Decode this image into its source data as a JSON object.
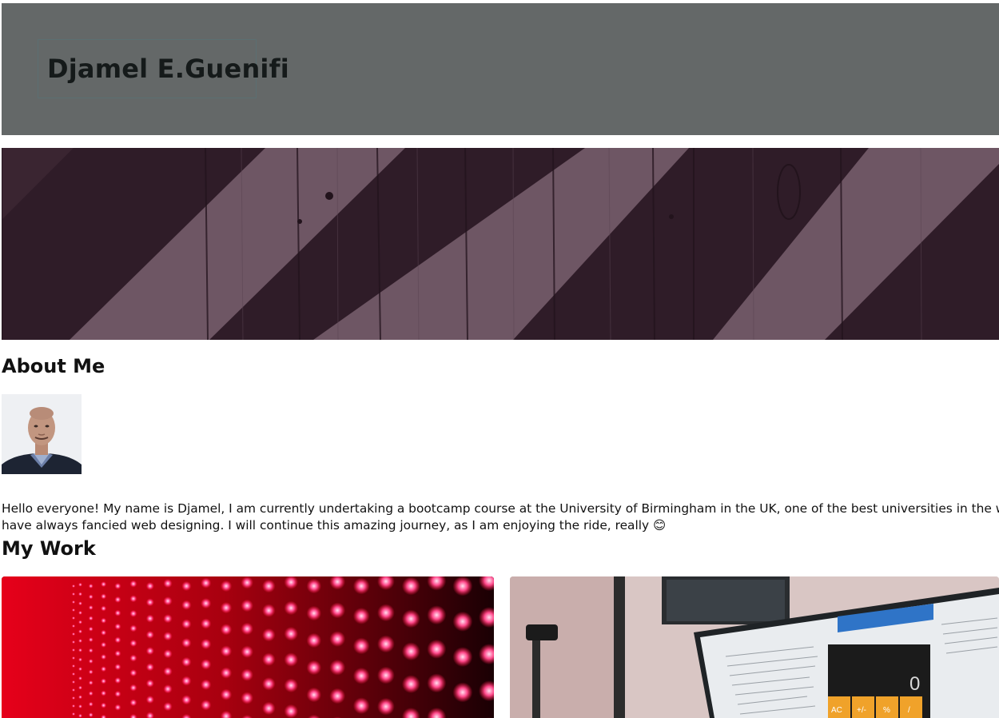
{
  "header": {
    "brand_name": "Djamel E.Guenifi"
  },
  "hero": {
    "image": "wood-plank-diagonal-stripes",
    "colors": {
      "dark": "#2f1c28",
      "light": "#6e5664"
    }
  },
  "about": {
    "title": "About Me",
    "avatar": "profile-photo",
    "bio_line_1": "Hello everyone! My name is Djamel, I am currently undertaking a bootcamp course at the University of Birmingham in the UK, one of the best universities in the world. I have",
    "bio_line_2": "have always fancied web designing. I will continue this amazing journey, as I am enjoying the ride, really 😊"
  },
  "work": {
    "title": "My Work",
    "projects": [
      {
        "image": "red-led-wall"
      },
      {
        "image": "laptop-calculator-app"
      }
    ],
    "calculator_display": "0",
    "calculator_keys": [
      "AC",
      "+/-",
      "%",
      "/"
    ]
  }
}
